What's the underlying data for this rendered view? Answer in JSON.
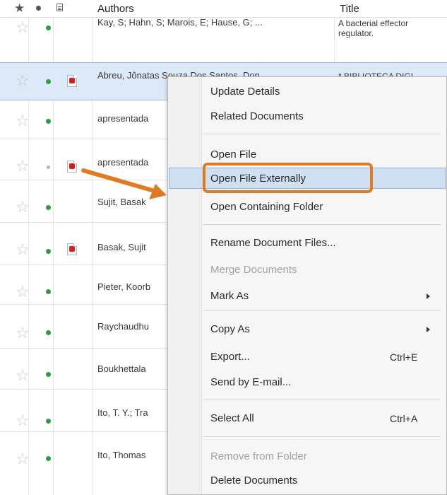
{
  "header": {
    "star_icon": "star-icon",
    "read_icon": "dot-icon",
    "file_icon": "document-icon",
    "authors_label": "Authors",
    "title_label": "Title"
  },
  "rows": [
    {
      "author": "Kay, S; Hahn, S; Marois, E; Hause, G; ...",
      "title_line1": "A bacterial effector",
      "title_line2": "regulator."
    },
    {
      "author": "Abreu, Jônatas Souza Dos Santos, Don...",
      "title_line1": "* BIBLIOTECA DIGI",
      "title_line2": ""
    },
    {
      "author": "apresentada",
      "title_line1": "",
      "title_line2": ""
    },
    {
      "author": "apresentada",
      "title_line1": "",
      "title_line2": ""
    },
    {
      "author": "Sujit, Basak",
      "title_line1": "",
      "title_line2": ""
    },
    {
      "author": "Basak, Sujit",
      "title_line1": "",
      "title_line2": ""
    },
    {
      "author": "Pieter, Koorb",
      "title_line1": "",
      "title_line2": ""
    },
    {
      "author": "Raychaudhu",
      "title_line1": "",
      "title_line2": ""
    },
    {
      "author": "Boukhettala",
      "title_line1": "",
      "title_line2": ""
    },
    {
      "author": "Ito, T. Y.; Tra",
      "title_line1": "",
      "title_line2": ""
    },
    {
      "author": "Ito, Thomas",
      "title_line1": "",
      "title_line2": ""
    }
  ],
  "context_menu": {
    "update_details": "Update Details",
    "related_documents": "Related Documents",
    "open_file": "Open File",
    "open_file_externally": "Open File Externally",
    "open_containing_folder": "Open Containing Folder",
    "rename_document_files": "Rename Document Files...",
    "merge_documents": "Merge Documents",
    "mark_as": "Mark As",
    "copy_as": "Copy As",
    "export": "Export...",
    "export_shortcut": "Ctrl+E",
    "send_by_email": "Send by E-mail...",
    "select_all": "Select All",
    "select_all_shortcut": "Ctrl+A",
    "remove_from_folder": "Remove from Folder",
    "delete_documents": "Delete Documents"
  },
  "colors": {
    "accent_highlight": "#e07b24",
    "selection": "#dce9f8",
    "read_dot": "#2e9c3f"
  }
}
